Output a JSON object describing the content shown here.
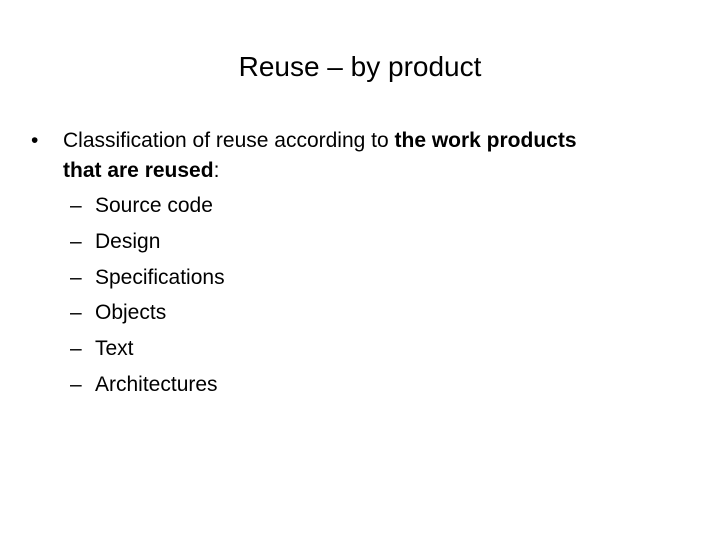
{
  "slide": {
    "title": "Reuse – by product",
    "bullet": {
      "marker": "•",
      "text_plain": "Classification of reuse according to ",
      "text_bold_1": "the work products",
      "text_bold_2": "that are reused",
      "text_end": ":"
    },
    "sub_marker": "–",
    "sub_items": [
      "Source code",
      "Design",
      "Specifications",
      "Objects",
      "Text",
      "Architectures"
    ]
  }
}
